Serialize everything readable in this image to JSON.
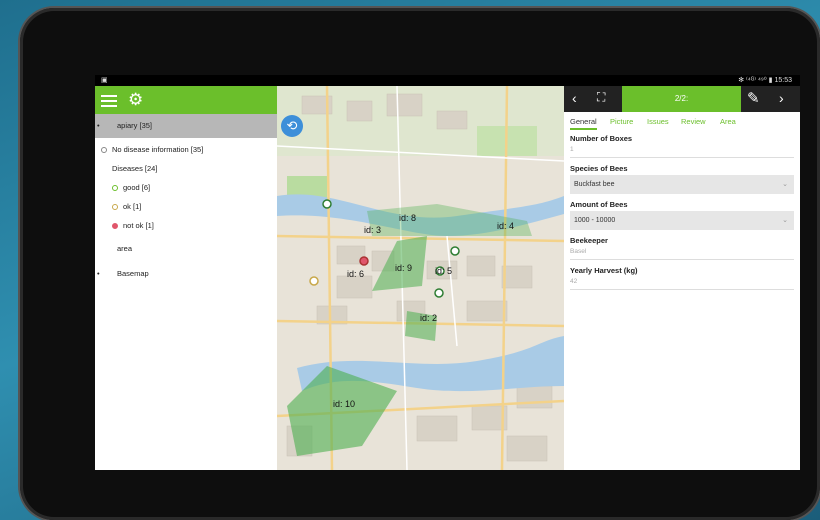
{
  "status": {
    "left": "▣",
    "right": "✻ ⁽⁴ᴳ⁾ ⁴⁹⁰ ▮ 15:53"
  },
  "layers": {
    "apiary": "apiary [35]",
    "no_disease": "No disease information [35]",
    "diseases": "Diseases [24]",
    "good": "good [6]",
    "ok": "ok [1]",
    "not_ok": "not ok [1]",
    "area": "area",
    "basemap": "Basemap"
  },
  "map": {
    "labels": [
      "id: 3",
      "id: 8",
      "id: 4",
      "id: 6",
      "id: 9",
      "id: 5",
      "id: 2",
      "id: 10"
    ]
  },
  "detail": {
    "pager": "2/2:",
    "tabs": [
      "General",
      "Picture",
      "Issues",
      "Review",
      "Area"
    ],
    "fields": {
      "boxes_label": "Number of Boxes",
      "boxes_value": "1",
      "species_label": "Species of Bees",
      "species_value": "Buckfast bee",
      "amount_label": "Amount of Bees",
      "amount_value": "1000 - 10000",
      "beekeeper_label": "Beekeeper",
      "beekeeper_value": "Basel",
      "harvest_label": "Yearly Harvest (kg)",
      "harvest_value": "42"
    }
  },
  "colors": {
    "accent": "#6bbf2b",
    "marker_bad": "#e0566b",
    "locate": "#3d8fd9"
  },
  "icons": [
    "menu-icon",
    "gear-icon",
    "locate-icon",
    "chevron-left-icon",
    "fullscreen-icon",
    "edit-icon",
    "chevron-right-icon"
  ]
}
